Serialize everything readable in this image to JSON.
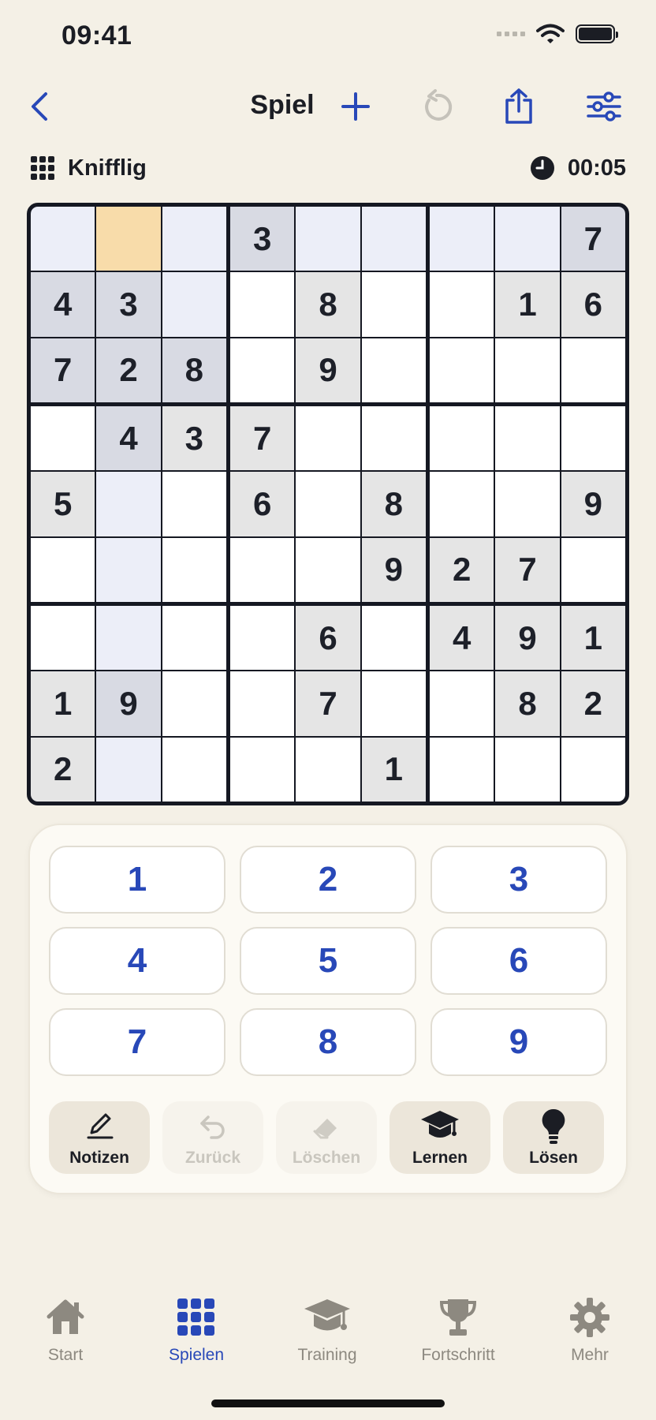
{
  "status": {
    "time": "09:41"
  },
  "nav": {
    "title": "Spiel"
  },
  "info": {
    "difficulty": "Knifflig",
    "timer": "00:05"
  },
  "board": {
    "selected": [
      0,
      1
    ],
    "cells": [
      [
        "",
        "",
        "",
        "3",
        "",
        "",
        "",
        "",
        "7"
      ],
      [
        "4",
        "3",
        "",
        "",
        "8",
        "",
        "",
        "1",
        "6"
      ],
      [
        "7",
        "2",
        "8",
        "",
        "9",
        "",
        "",
        "",
        ""
      ],
      [
        "",
        "4",
        "3",
        "7",
        "",
        "",
        "",
        "",
        ""
      ],
      [
        "5",
        "",
        "",
        "6",
        "",
        "8",
        "",
        "",
        "9"
      ],
      [
        "",
        "",
        "",
        "",
        "",
        "9",
        "2",
        "7",
        ""
      ],
      [
        "",
        "",
        "",
        "",
        "6",
        "",
        "4",
        "9",
        "1"
      ],
      [
        "1",
        "9",
        "",
        "",
        "7",
        "",
        "",
        "8",
        "2"
      ],
      [
        "2",
        "",
        "",
        "",
        "",
        "1",
        "",
        "",
        ""
      ]
    ]
  },
  "keypad": [
    "1",
    "2",
    "3",
    "4",
    "5",
    "6",
    "7",
    "8",
    "9"
  ],
  "tools": [
    {
      "label": "Notizen",
      "icon": "pencil-icon",
      "state": "active"
    },
    {
      "label": "Zurück",
      "icon": "undo-arrow-icon",
      "state": "disabled"
    },
    {
      "label": "Löschen",
      "icon": "eraser-icon",
      "state": "disabled"
    },
    {
      "label": "Lernen",
      "icon": "graduation-cap-icon",
      "state": "active"
    },
    {
      "label": "Lösen",
      "icon": "lightbulb-icon",
      "state": "active"
    }
  ],
  "tabs": [
    {
      "label": "Start",
      "icon": "house-icon",
      "active": false
    },
    {
      "label": "Spielen",
      "icon": "grid-icon",
      "active": true
    },
    {
      "label": "Training",
      "icon": "graduation-cap-icon",
      "active": false
    },
    {
      "label": "Fortschritt",
      "icon": "trophy-icon",
      "active": false
    },
    {
      "label": "Mehr",
      "icon": "gear-icon",
      "active": false
    }
  ],
  "colors": {
    "accent": "#2848b8",
    "background": "#f4f0e6",
    "selected_cell": "#f8dcaa",
    "peer_cell": "#eceef8",
    "given_cell": "#e5e5e5"
  }
}
